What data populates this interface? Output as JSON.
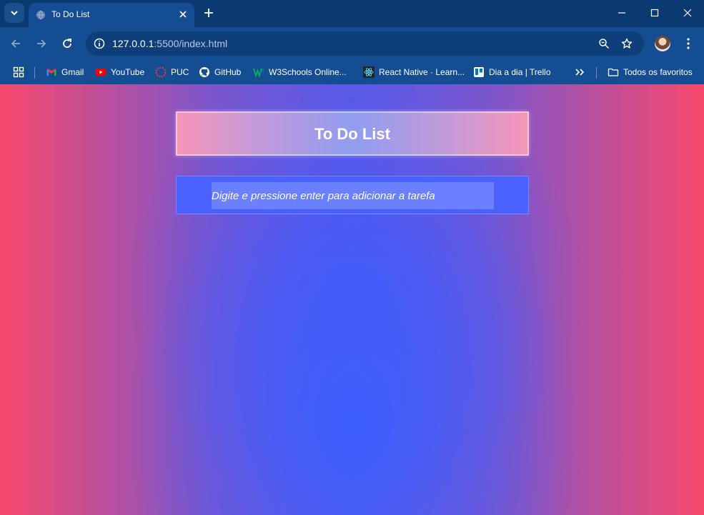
{
  "browser": {
    "tab_title": "To Do List",
    "url_host": "127.0.0.1",
    "url_path": ":5500/index.html"
  },
  "bookmarks": {
    "items": [
      "Gmail",
      "YouTube",
      "PUC",
      "GitHub",
      "W3Schools Online...",
      "React Native · Learn...",
      "Dia a dia | Trello"
    ],
    "all_bookmarks": "Todos os favoritos"
  },
  "app": {
    "title": "To Do List",
    "input_placeholder": "Digite e pressione enter para adicionar a tarefa"
  },
  "colors": {
    "chrome_dark": "#0b3a73",
    "chrome_toolbar": "#154d92",
    "page_edge": "#f8486a",
    "page_center": "#3c5fff",
    "input_card": "#4a60ff"
  }
}
